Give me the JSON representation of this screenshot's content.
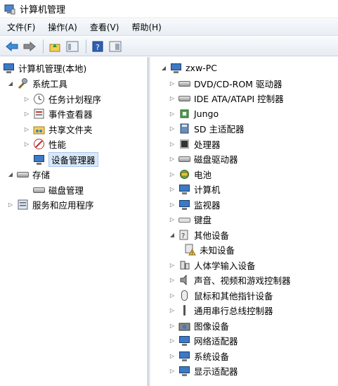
{
  "window": {
    "title": "计算机管理"
  },
  "menu": [
    "文件(F)",
    "操作(A)",
    "查看(V)",
    "帮助(H)"
  ],
  "left_tree": {
    "root": "计算机管理(本地)",
    "system_tools": "系统工具",
    "task_scheduler": "任务计划程序",
    "event_viewer": "事件查看器",
    "shared_folders": "共享文件夹",
    "performance": "性能",
    "device_manager": "设备管理器",
    "storage": "存储",
    "disk_management": "磁盘管理",
    "services_apps": "服务和应用程序"
  },
  "right_tree": {
    "computer": "zxw-PC",
    "items": [
      "DVD/CD-ROM 驱动器",
      "IDE ATA/ATAPI 控制器",
      "Jungo",
      "SD 主适配器",
      "处理器",
      "磁盘驱动器",
      "电池",
      "计算机",
      "监视器",
      "键盘",
      "其他设备",
      "未知设备",
      "人体学输入设备",
      "声音、视频和游戏控制器",
      "鼠标和其他指针设备",
      "通用串行总线控制器",
      "图像设备",
      "网络适配器",
      "系统设备",
      "显示适配器"
    ]
  }
}
